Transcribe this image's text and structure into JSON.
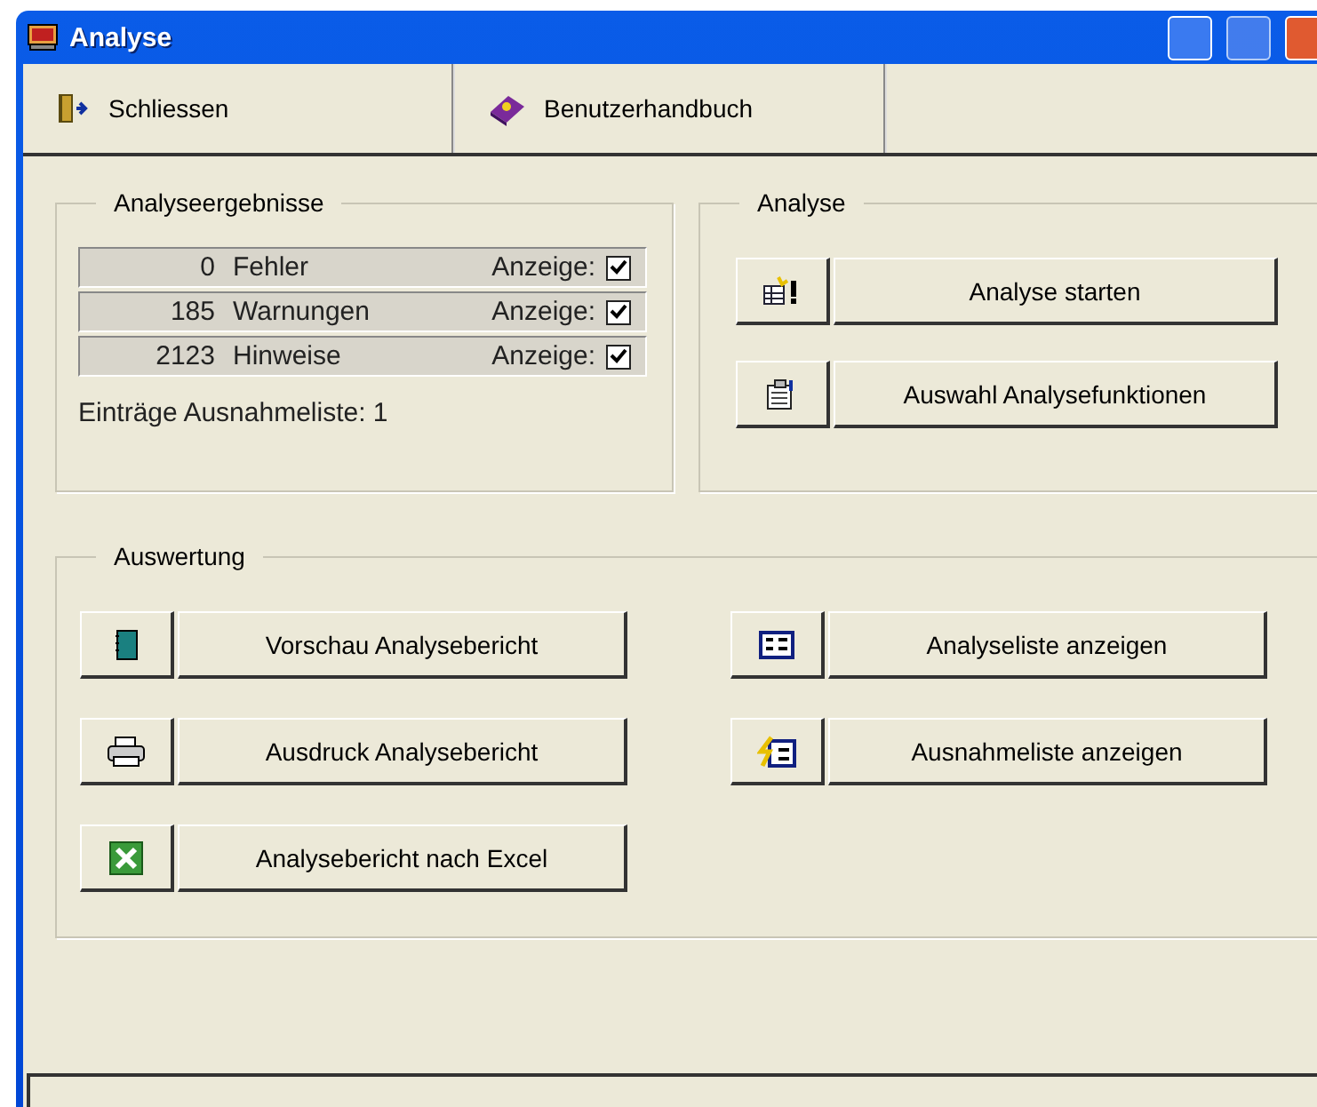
{
  "window": {
    "title": "Analyse"
  },
  "toolbar": [
    {
      "label": "Schliessen",
      "kind": "door"
    },
    {
      "label": "Benutzerhandbuch",
      "kind": "book"
    }
  ],
  "results": {
    "title": "Analyseergebnisse",
    "rows": [
      {
        "count": "0",
        "label": "Fehler",
        "display_label": "Anzeige:",
        "checked": true
      },
      {
        "count": "185",
        "label": "Warnungen",
        "display_label": "Anzeige:",
        "checked": true
      },
      {
        "count": "2123",
        "label": "Hinweise",
        "display_label": "Anzeige:",
        "checked": true
      }
    ],
    "exceptions": "Einträge Ausnahmeliste: 1"
  },
  "analysis": {
    "title": "Analyse",
    "buttons": [
      {
        "label": "Analyse starten",
        "kind": "start"
      },
      {
        "label": "Auswahl Analysefunktionen",
        "kind": "select"
      }
    ]
  },
  "evaluation": {
    "title": "Auswertung",
    "left_buttons": [
      {
        "label": "Vorschau Analysebericht",
        "kind": "preview"
      },
      {
        "label": "Ausdruck Analysebericht",
        "kind": "print"
      },
      {
        "label": "Analysebericht nach Excel",
        "kind": "excel"
      }
    ],
    "right_buttons": [
      {
        "label": "Analyseliste anzeigen",
        "kind": "list"
      },
      {
        "label": "Ausnahmeliste anzeigen",
        "kind": "exceptions"
      }
    ]
  }
}
